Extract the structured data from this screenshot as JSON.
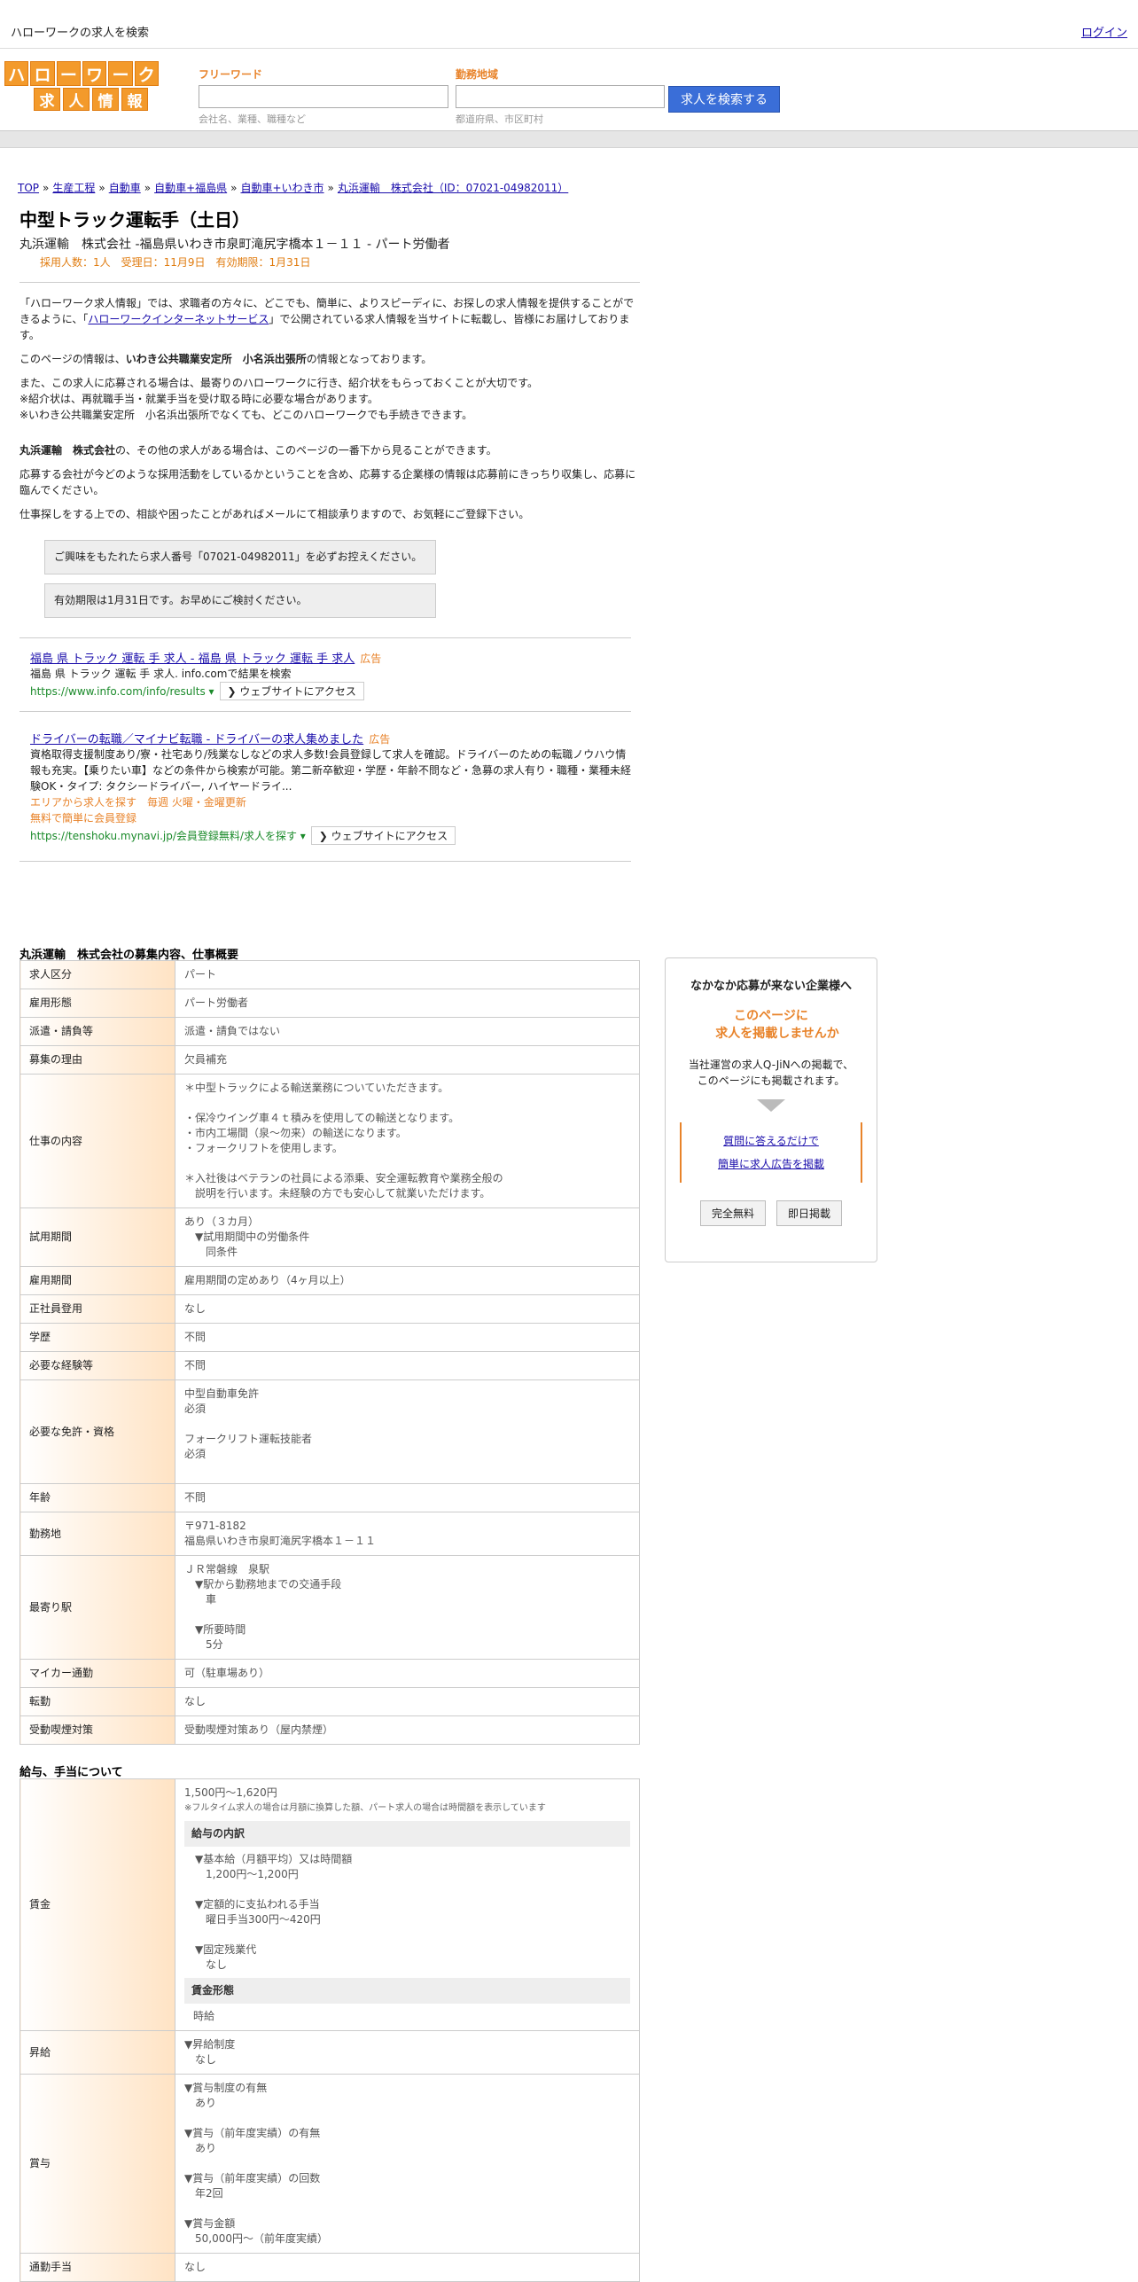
{
  "topbar": {
    "site_title": "ハローワークの求人を検索",
    "login": "ログイン"
  },
  "logo": {
    "row1": [
      "ハ",
      "ロ",
      "ー",
      "ワ",
      "ー",
      "ク"
    ],
    "row2": [
      "求",
      "人",
      "情",
      "報"
    ]
  },
  "search": {
    "freeword_label": "フリーワード",
    "freeword_hint": "会社名、業種、職種など",
    "area_label": "勤務地域",
    "area_hint": "都道府県、市区町村",
    "button": "求人を検索する"
  },
  "breadcrumb": [
    "TOP",
    "生産工程",
    "自動車",
    "自動車+福島県",
    "自動車+いわき市",
    "丸浜運輸　株式会社（ID：07021-04982011）"
  ],
  "job": {
    "title": "中型トラック運転手（土日）",
    "sub": "丸浜運輸　株式会社 -福島県いわき市泉町滝尻字橋本１－１１ - パート労働者",
    "meta": "採用人数：1人　受理日：11月9日　有効期限：1月31日"
  },
  "paras": {
    "p1a": "「ハローワーク求人情報」では、求職者の方々に、どこでも、簡単に、よりスピーディに、お探しの求人情報を提供することができるように、「",
    "p1link": "ハローワークインターネットサービス",
    "p1b": "」で公開されている求人情報を当サイトに転載し、皆様にお届けしております。",
    "p2a": "このページの情報は、",
    "p2b": "いわき公共職業安定所　小名浜出張所",
    "p2c": "の情報となっております。",
    "p3": "また、この求人に応募される場合は、最寄りのハローワークに行き、紹介状をもらっておくことが大切です。",
    "p4": "※紹介状は、再就職手当・就業手当を受け取る時に必要な場合があります。",
    "p5": "※いわき公共職業安定所　小名浜出張所でなくても、どこのハローワークでも手続きできます。",
    "p6a": "丸浜運輸　株式会社",
    "p6b": "の、その他の求人がある場合は、このページの一番下から見ることができます。",
    "p7": "応募する会社が今どのような採用活動をしているかということを含め、応募する企業様の情報は応募前にきっちり収集し、応募に臨んでください。",
    "p8": "仕事探しをする上での、相談や困ったことがあればメールにて相談承りますので、お気軽にご登録下さい。"
  },
  "notices": [
    "ご興味をもたれたら求人番号「07021-04982011」を必ずお控えください。",
    "有効期限は1月31日です。お早めにご検討ください。"
  ],
  "ads": [
    {
      "title": "福島 県 トラック 運転 手 求人 - 福島 県 トラック 運転 手 求人",
      "tag": "広告",
      "desc": "福島 県 トラック 運転 手 求人. info.comで結果を検索",
      "url": "https://www.info.com/info/results",
      "visit": "❯ ウェブサイトにアクセス"
    },
    {
      "title": "ドライバーの転職／マイナビ転職 - ドライバーの求人集めました",
      "tag": "広告",
      "desc": "資格取得支援制度あり/寮・社宅あり/残業なしなどの求人多数!会員登録して求人を確認。ドライバーのための転職ノウハウ情報も充実。【乗りたい車】などの条件から検索が可能。第二新卒歓迎・学歴・年齢不問など・急募の求人有り・職種・業種未経験OK・タイプ: タクシードライバー, ハイヤードライ...",
      "offer1": "エリアから求人を探す　毎週 火曜・金曜更新",
      "offer2": "無料で簡単に会員登録",
      "url": "https://tenshoku.mynavi.jp/会員登録無料/求人を探す",
      "visit": "❯ ウェブサイトにアクセス"
    }
  ],
  "section1": {
    "title": "丸浜運輸　株式会社の募集内容、仕事概要",
    "rows": [
      {
        "k": "求人区分",
        "v": [
          "パート"
        ]
      },
      {
        "k": "雇用形態",
        "v": [
          "パート労働者"
        ]
      },
      {
        "k": "派遣・請負等",
        "v": [
          "派遣・請負ではない"
        ]
      },
      {
        "k": "募集の理由",
        "v": [
          "欠員補充"
        ]
      },
      {
        "k": "仕事の内容",
        "v": [
          "＊中型トラックによる輸送業務についていただきます。",
          "",
          "・保冷ウイング車４ｔ積みを使用しての輸送となります。",
          "・市内工場間（泉～勿来）の輸送になります。",
          "・フォークリフトを使用します。",
          "",
          "＊入社後はベテランの社員による添乗、安全運転教育や業務全般の",
          "　説明を行います。未経験の方でも安心して就業いただけます。"
        ]
      },
      {
        "k": "試用期間",
        "v": [
          "あり（３カ月）",
          "　▼試用期間中の労働条件",
          "　　同条件"
        ]
      },
      {
        "k": "雇用期間",
        "v": [
          "雇用期間の定めあり（4ヶ月以上）"
        ]
      },
      {
        "k": "正社員登用",
        "v": [
          "なし"
        ]
      },
      {
        "k": "学歴",
        "v": [
          "不問"
        ]
      },
      {
        "k": "必要な経験等",
        "v": [
          "不問"
        ]
      },
      {
        "k": "必要な免許・資格",
        "v": [
          "中型自動車免許",
          "必須",
          "",
          "フォークリフト運転技能者",
          "必須",
          ""
        ]
      },
      {
        "k": "年齢",
        "v": [
          "不問"
        ]
      },
      {
        "k": "勤務地",
        "v": [
          "〒971-8182",
          "福島県いわき市泉町滝尻字橋本１－１１"
        ]
      },
      {
        "k": "最寄り駅",
        "v": [
          "ＪＲ常磐線　泉駅",
          "　▼駅から勤務地までの交通手段",
          "　　車",
          "",
          "　▼所要時間",
          "　　5分"
        ]
      },
      {
        "k": "マイカー通勤",
        "v": [
          "可（駐車場あり）"
        ]
      },
      {
        "k": "転勤",
        "v": [
          "なし"
        ]
      },
      {
        "k": "受動喫煙対策",
        "v": [
          "受動喫煙対策あり（屋内禁煙）"
        ]
      }
    ]
  },
  "section2": {
    "title": "給与、手当について",
    "wage_label": "賃金",
    "wage_range": "1,500円〜1,620円",
    "wage_note": "※フルタイム求人の場合は月額に換算した額、パート求人の場合は時間額を表示しています",
    "breakdown_head": "給与の内訳",
    "breakdown": [
      "　▼基本給（月額平均）又は時間額",
      "　　1,200円〜1,200円",
      "",
      "　▼定額的に支払われる手当",
      "　　曜日手当300円〜420円",
      "",
      "　▼固定残業代",
      "　　なし"
    ],
    "wage_form_head": "賃金形態",
    "wage_form": "時給",
    "raise_label": "昇給",
    "raise": [
      "▼昇給制度",
      "　なし"
    ],
    "bonus_label": "賞与",
    "bonus": [
      "▼賞与制度の有無",
      "　あり",
      "",
      "▼賞与（前年度実績）の有無",
      "　あり",
      "",
      "▼賞与（前年度実績）の回数",
      "　年2回",
      "",
      "▼賞与金額",
      "　50,000円〜（前年度実績）"
    ],
    "commute_label": "通勤手当",
    "commute": "なし"
  },
  "sidebar": {
    "head": "なかなか応募が来ない企業様へ",
    "orange1": "このページに",
    "orange2": "　求人を掲載しませんか",
    "p1": "当社運営の求人Q-JiNへの掲載で、",
    "p2": "このページにも掲載されます。",
    "link1": "質問に答えるだけで",
    "link2": "簡単に求人広告を掲載",
    "btn1": "完全無料",
    "btn2": "即日掲載"
  }
}
